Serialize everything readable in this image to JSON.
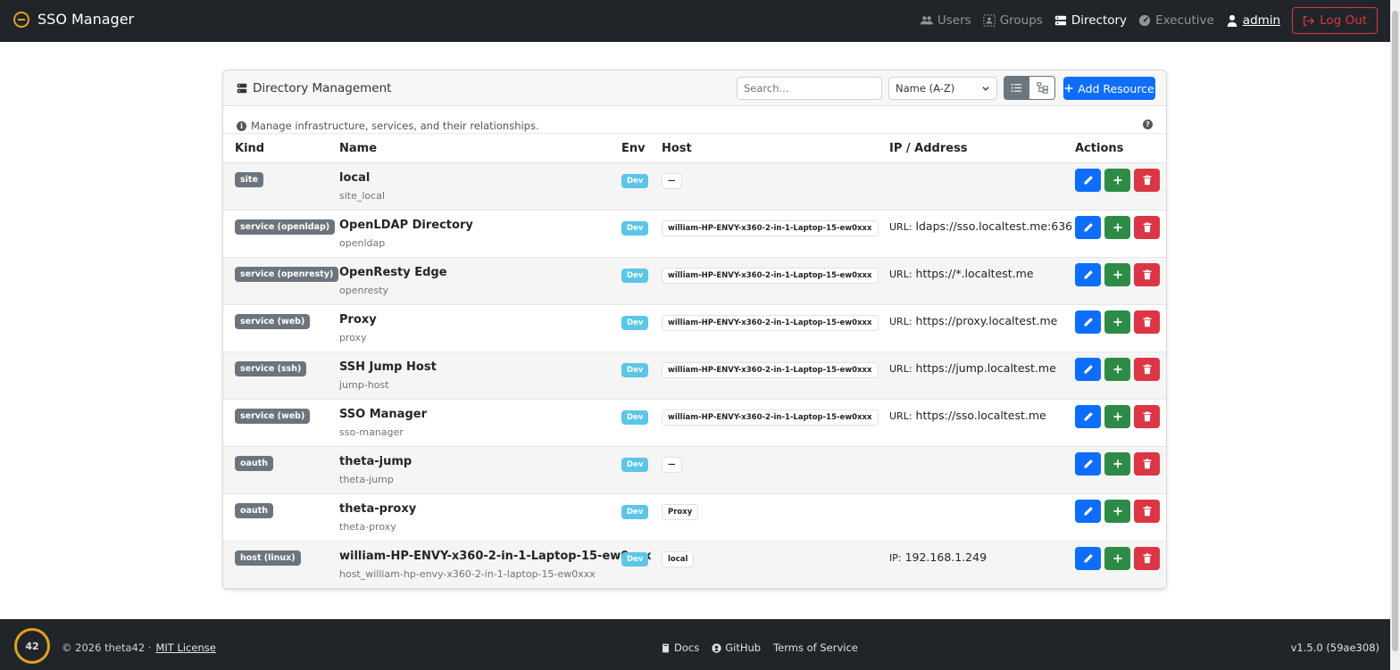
{
  "navbar": {
    "brand": "SSO Manager",
    "links": {
      "users": "Users",
      "groups": "Groups",
      "directory": "Directory",
      "executive": "Executive",
      "admin": "admin"
    },
    "logout": "Log Out"
  },
  "card": {
    "title": "Directory Management",
    "search_placeholder": "Search...",
    "sort_value": "Name (A-Z)",
    "add_button": "Add Resource",
    "info": "Manage infrastructure, services, and their relationships.",
    "help": "?"
  },
  "table": {
    "headers": {
      "kind": "Kind",
      "name": "Name",
      "env": "Env",
      "host": "Host",
      "ip": "IP / Address",
      "actions": "Actions"
    },
    "rows": [
      {
        "kind": "site",
        "name": "local",
        "sub": "site_local",
        "env": "Dev",
        "host": "—",
        "ip_prefix": "",
        "ip": ""
      },
      {
        "kind": "service (openldap)",
        "name": "OpenLDAP Directory",
        "sub": "openldap",
        "env": "Dev",
        "host": "william-HP-ENVY-x360-2-in-1-Laptop-15-ew0xxx",
        "ip_prefix": "URL:",
        "ip": "ldaps://sso.localtest.me:636"
      },
      {
        "kind": "service (openresty)",
        "name": "OpenResty Edge",
        "sub": "openresty",
        "env": "Dev",
        "host": "william-HP-ENVY-x360-2-in-1-Laptop-15-ew0xxx",
        "ip_prefix": "URL:",
        "ip": "https://*.localtest.me"
      },
      {
        "kind": "service (web)",
        "name": "Proxy",
        "sub": "proxy",
        "env": "Dev",
        "host": "william-HP-ENVY-x360-2-in-1-Laptop-15-ew0xxx",
        "ip_prefix": "URL:",
        "ip": "https://proxy.localtest.me"
      },
      {
        "kind": "service (ssh)",
        "name": "SSH Jump Host",
        "sub": "jump-host",
        "env": "Dev",
        "host": "william-HP-ENVY-x360-2-in-1-Laptop-15-ew0xxx",
        "ip_prefix": "URL:",
        "ip": "https://jump.localtest.me"
      },
      {
        "kind": "service (web)",
        "name": "SSO Manager",
        "sub": "sso-manager",
        "env": "Dev",
        "host": "william-HP-ENVY-x360-2-in-1-Laptop-15-ew0xxx",
        "ip_prefix": "URL:",
        "ip": "https://sso.localtest.me"
      },
      {
        "kind": "oauth",
        "name": "theta-jump",
        "sub": "theta-jump",
        "env": "Dev",
        "host": "—",
        "ip_prefix": "",
        "ip": ""
      },
      {
        "kind": "oauth",
        "name": "theta-proxy",
        "sub": "theta-proxy",
        "env": "Dev",
        "host": "Proxy",
        "ip_prefix": "",
        "ip": ""
      },
      {
        "kind": "host (linux)",
        "name": "william-HP-ENVY-x360-2-in-1-Laptop-15-ew0xxx",
        "sub": "host_william-hp-envy-x360-2-in-1-laptop-15-ew0xxx",
        "env": "Dev",
        "host": "local",
        "ip_prefix": "IP:",
        "ip": "192.168.1.249"
      }
    ]
  },
  "footer": {
    "logo_text": "42",
    "copyright": "© 2026 theta42 ·",
    "license": "MIT License",
    "docs": "Docs",
    "github": "GitHub",
    "terms": "Terms of Service",
    "version": "v1.5.0 (59ae308)"
  },
  "colors": {
    "navbar_bg": "#212529",
    "primary": "#0d6efd",
    "success": "#2e8b46",
    "danger": "#dc3545",
    "info": "#5bc6e8",
    "secondary": "#6c757d",
    "brand_gold": "#e0a31f"
  }
}
